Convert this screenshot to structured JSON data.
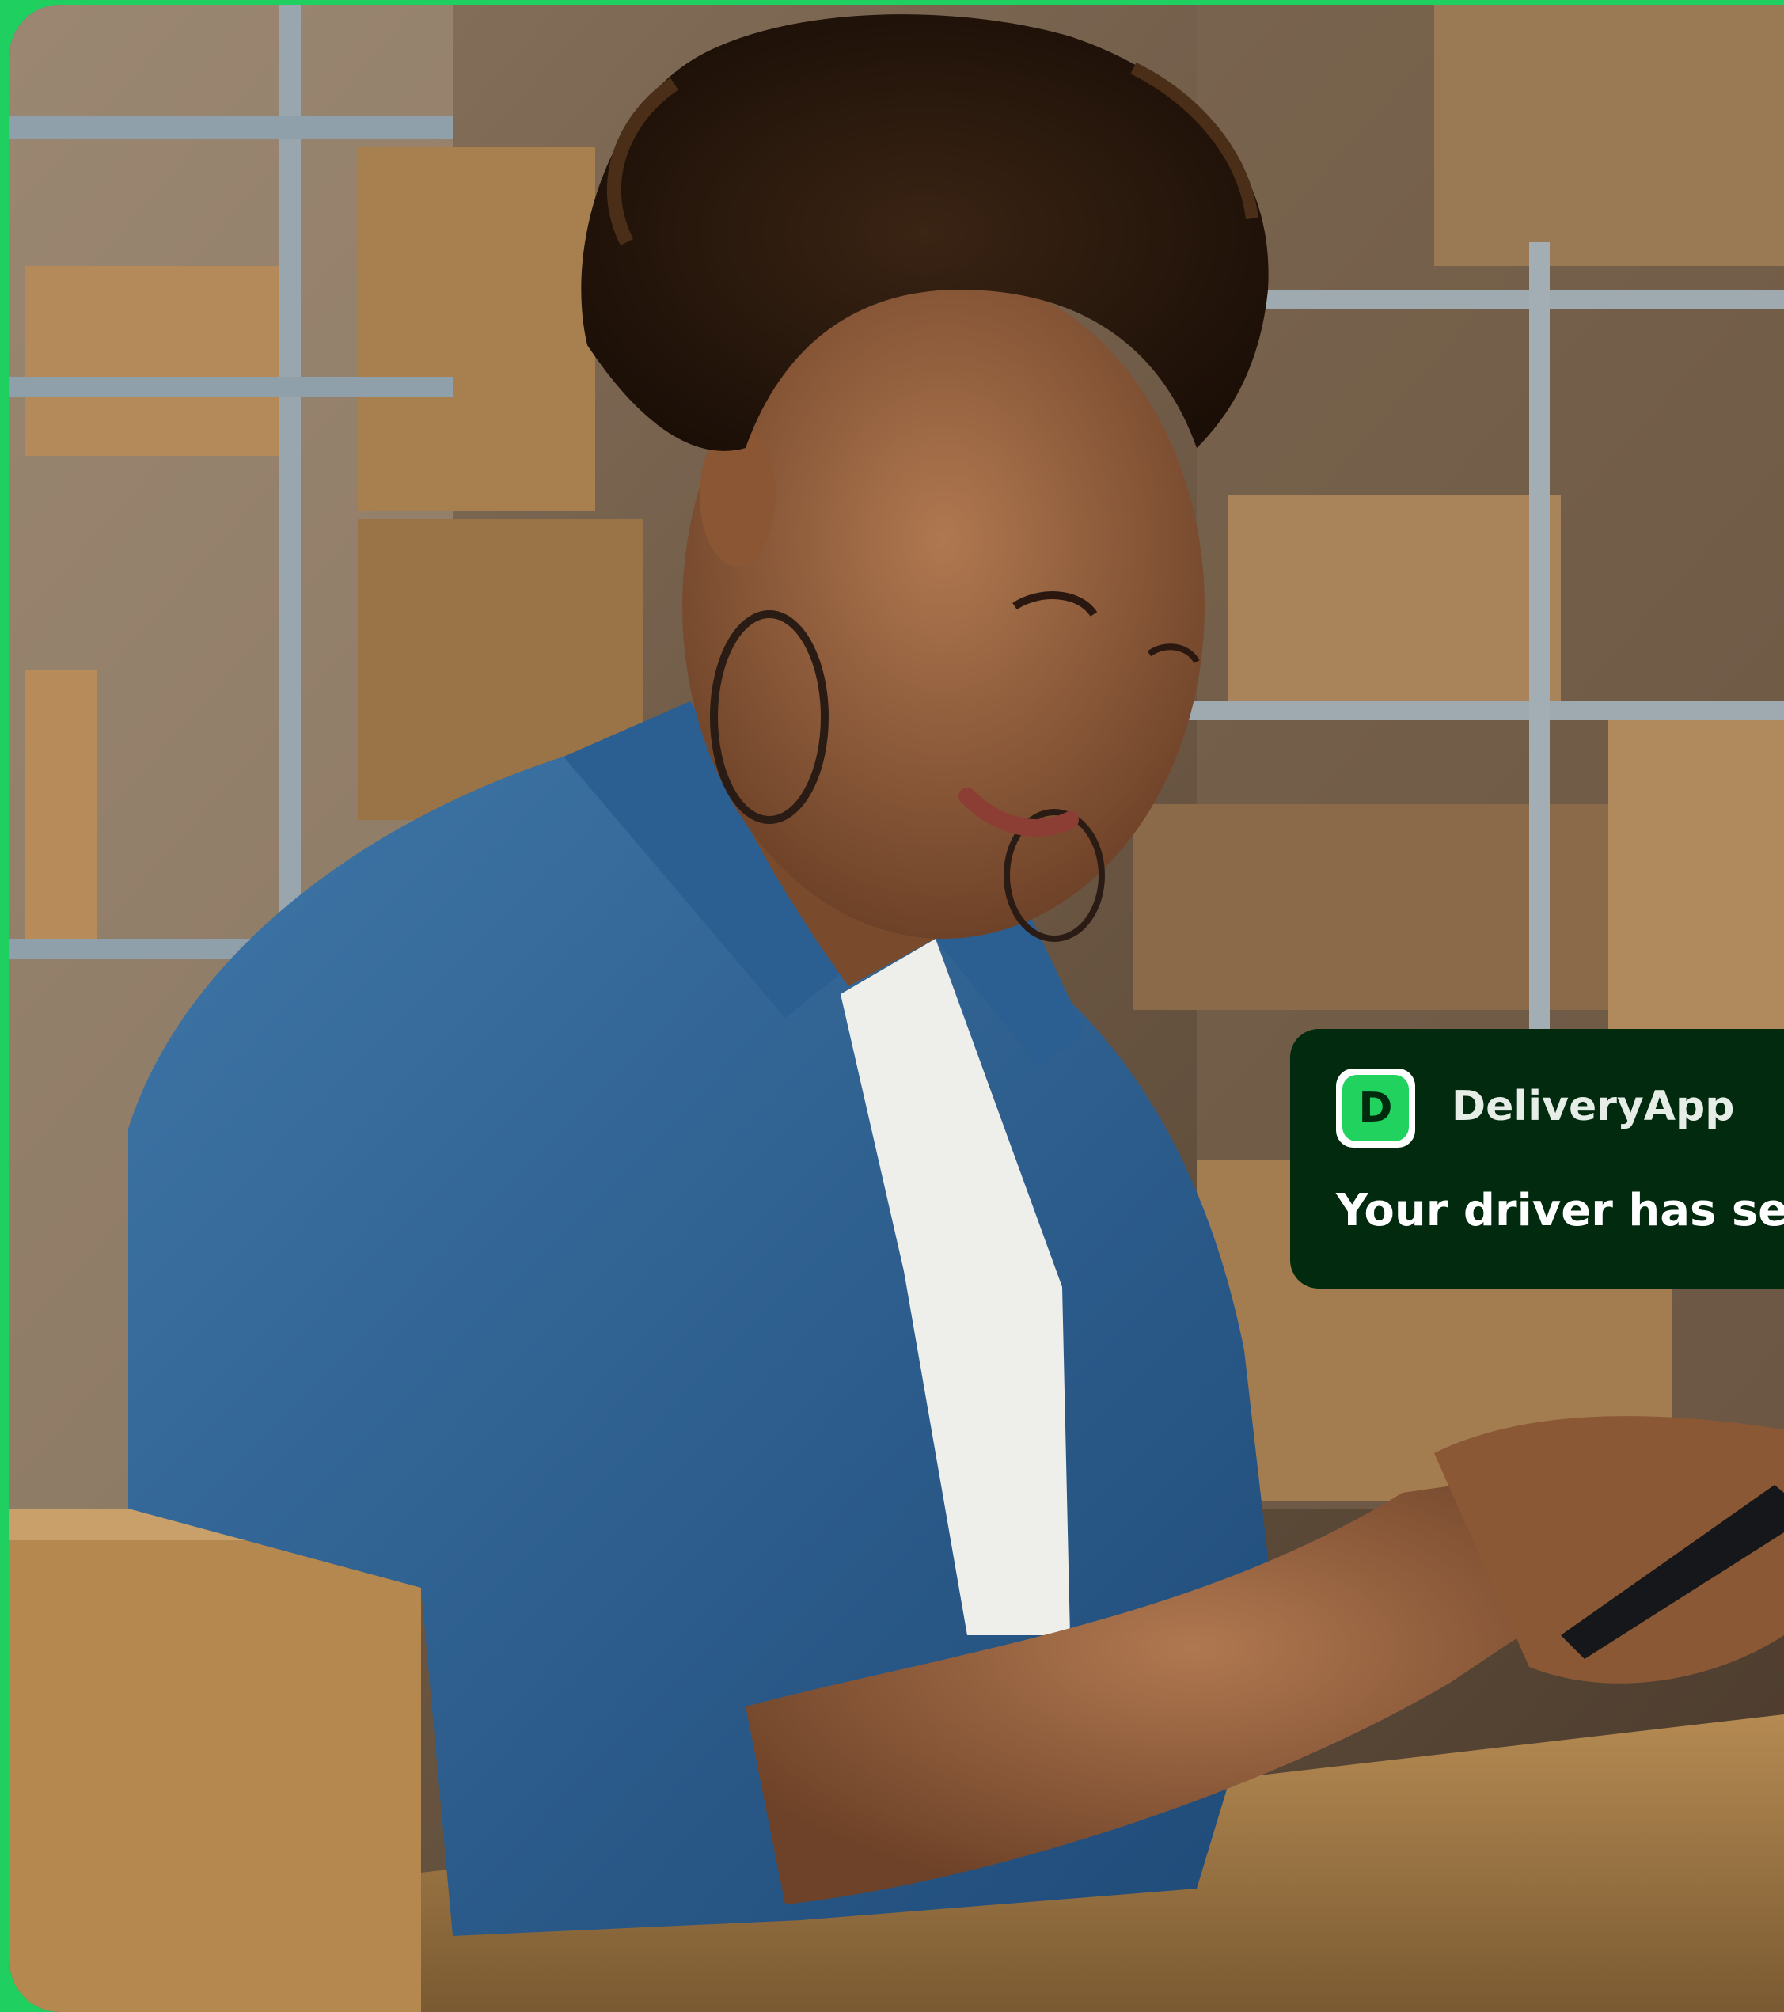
{
  "notification": {
    "app_icon_letter": "D",
    "app_name": "DeliveryApp",
    "message": "Your driver has ser"
  },
  "colors": {
    "accent_green": "#1fd060",
    "notification_bg": "#022a0e",
    "app_icon_green": "#21d25f",
    "text_white": "#ffffff"
  },
  "photo": {
    "subject": "woman-using-smartphone-in-warehouse"
  }
}
